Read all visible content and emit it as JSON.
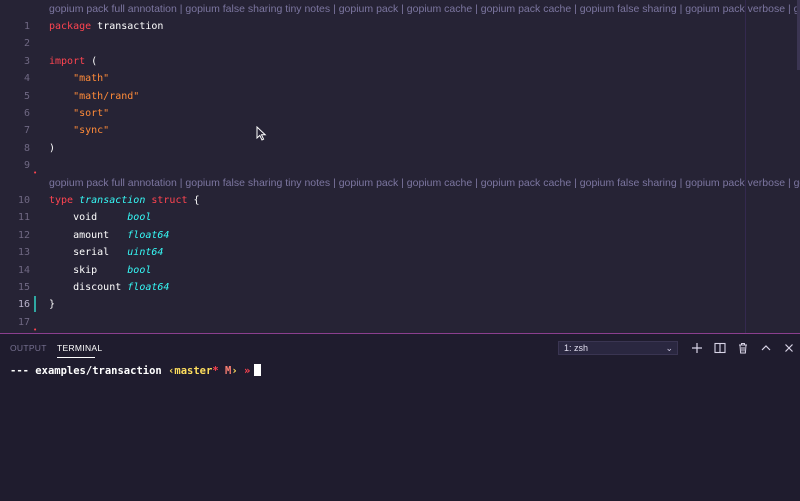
{
  "editor": {
    "code_lens": "gopium pack full annotation | gopium false sharing tiny notes | gopium pack | gopium cache | gopium pack cache | gopium false sharing | gopium pack verbose | gopium cache",
    "lines": [
      {
        "n": "1",
        "tokens": [
          [
            "kw",
            "package"
          ],
          [
            "ident",
            " transaction"
          ]
        ]
      },
      {
        "n": "2",
        "tokens": []
      },
      {
        "n": "3",
        "tokens": [
          [
            "kw",
            "import"
          ],
          [
            "paren",
            " ("
          ]
        ]
      },
      {
        "n": "4",
        "tokens": [
          [
            "str",
            "    \"math\""
          ]
        ]
      },
      {
        "n": "5",
        "tokens": [
          [
            "str",
            "    \"math/rand\""
          ]
        ]
      },
      {
        "n": "6",
        "tokens": [
          [
            "str",
            "    \"sort\""
          ]
        ]
      },
      {
        "n": "7",
        "tokens": [
          [
            "str",
            "    \"sync\""
          ]
        ]
      },
      {
        "n": "8",
        "tokens": [
          [
            "paren",
            ")"
          ]
        ]
      },
      {
        "n": "9",
        "tokens": []
      },
      {
        "n": "10",
        "tokens": [
          [
            "kw",
            "type"
          ],
          [
            "typ2",
            " transaction"
          ],
          [
            "kw",
            " struct"
          ],
          [
            "paren",
            " {"
          ]
        ]
      },
      {
        "n": "11",
        "tokens": [
          [
            "ident",
            "    void     "
          ],
          [
            "typ2",
            "bool"
          ]
        ]
      },
      {
        "n": "12",
        "tokens": [
          [
            "ident",
            "    amount   "
          ],
          [
            "typ2",
            "float64"
          ]
        ]
      },
      {
        "n": "13",
        "tokens": [
          [
            "ident",
            "    serial   "
          ],
          [
            "typ2",
            "uint64"
          ]
        ]
      },
      {
        "n": "14",
        "tokens": [
          [
            "ident",
            "    skip     "
          ],
          [
            "typ2",
            "bool"
          ]
        ]
      },
      {
        "n": "15",
        "tokens": [
          [
            "ident",
            "    discount "
          ],
          [
            "typ2",
            "float64"
          ]
        ]
      },
      {
        "n": "16",
        "tokens": [
          [
            "paren",
            "}"
          ]
        ]
      },
      {
        "n": "17",
        "tokens": []
      }
    ]
  },
  "panel": {
    "tabs": [
      {
        "label": "OUTPUT",
        "active": false
      },
      {
        "label": "TERMINAL",
        "active": true
      }
    ],
    "terminal_select": "1: zsh",
    "icons": [
      "plus-icon",
      "split-icon",
      "trash-icon",
      "chevron-up-icon",
      "close-icon"
    ]
  },
  "terminal": {
    "prompt_dash": "---",
    "path": "examples/transaction",
    "branch_open": "‹",
    "branch": "master",
    "star": "*",
    "mod": "M",
    "branch_close": "›",
    "arrow": "»"
  },
  "colors": {
    "background": "#262335",
    "panel_background": "#1f1c2e",
    "keyword": "#fe4450",
    "string": "#ff8b39",
    "type": "#36f9f6",
    "code_lens": "#7c76a0",
    "panel_border": "#8b3f8f"
  }
}
